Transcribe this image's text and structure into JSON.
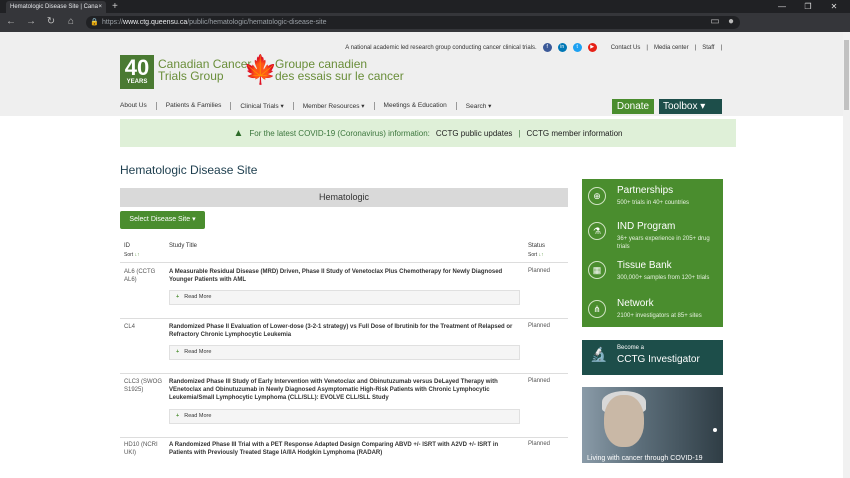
{
  "browser": {
    "tab_title": "Hematologic Disease Site | Cana",
    "tab_close": "×",
    "new_tab": "+",
    "url_scheme": "https://",
    "url_host": "www.ctg.queensu.ca",
    "url_path": "/public/hematologic/hematologic-disease-site",
    "window_buttons": [
      "—",
      "❐",
      "✕"
    ]
  },
  "header": {
    "tagline": "A national academic led research group conducting cancer clinical trials.",
    "social": [
      "f",
      "in",
      "t",
      "▶"
    ],
    "social_colors": [
      "#3b5998",
      "#0077b5",
      "#1da1f2",
      "#e62117"
    ],
    "links": [
      "Contact Us",
      "Media center",
      "Staff"
    ],
    "logo_number": "40",
    "logo_years": "YEARS",
    "logo_en_line1": "Canadian Cancer",
    "logo_en_line2": "Trials Group",
    "logo_fr_line1": "Groupe canadien",
    "logo_fr_line2": "des essais sur le cancer"
  },
  "nav": {
    "items": [
      "About Us",
      "Patients & Families",
      "Clinical Trials ▾",
      "Member Resources ▾",
      "Meetings & Education",
      "Search ▾"
    ],
    "donate": "Donate",
    "toolbox": "Toolbox ▾"
  },
  "alert": {
    "text": "For the latest COVID-19 (Coronavirus) information:",
    "link1": "CCTG public updates",
    "sep": "|",
    "link2": "CCTG member information"
  },
  "page": {
    "title": "Hematologic Disease Site",
    "section": "Hematologic",
    "select_button": "Select Disease Site ▾"
  },
  "table": {
    "col_id": "ID",
    "col_title": "Study Title",
    "col_status": "Status",
    "sort_label": "Sort",
    "sort_arrows": "↓↑",
    "read_more_icon": "+",
    "read_more": "Read More",
    "rows": [
      {
        "id": "AL6 (CCTG AL6)",
        "title": "A Measurable Residual Disease (MRD) Driven, Phase II Study of Venetoclax Plus Chemotherapy for Newly Diagnosed Younger Patients with AML",
        "status": "Planned"
      },
      {
        "id": "CL4",
        "title": "Randomized Phase II Evaluation of Lower-dose (3-2-1 strategy) vs Full Dose of Ibrutinib for the Treatment of Relapsed or Refractory Chronic Lymphocytic Leukemia",
        "status": "Planned"
      },
      {
        "id": "CLC3 (SWOG S1925)",
        "title": "Randomized Phase III Study of Early Intervention with Venetoclax and Obinutuzumab versus DeLayed Therapy with VEnetoclax and Obinutuzumab in Newly Diagnosed Asymptomatic High-Risk Patients with Chronic Lymphocytic Leukemia/Small Lymphocytic Lymphoma (CLL/SLL): EVOLVE CLL/SLL Study",
        "status": "Planned"
      },
      {
        "id": "HD10 (NCRI UKI)",
        "title": "A Randomized Phase III Trial with a PET Response Adapted Design Comparing ABVD +/- ISRT with A2VD +/- ISRT in Patients with Previously Treated Stage IA/IIA Hodgkin Lymphoma (RADAR)",
        "status": "Planned"
      }
    ]
  },
  "sidebar": {
    "items": [
      {
        "title": "Partnerships",
        "sub": "500+ trials in 40+ countries",
        "icon": "globe-icon"
      },
      {
        "title": "IND Program",
        "sub": "36+ years experience in 205+ drug trials",
        "icon": "flask-icon"
      },
      {
        "title": "Tissue Bank",
        "sub": "300,000+ samples from 120+ trials",
        "icon": "sample-icon"
      },
      {
        "title": "Network",
        "sub": "2100+ investigators at 85+ sites",
        "icon": "network-icon"
      }
    ],
    "icon_glyphs": [
      "⊕",
      "⚗",
      "▦",
      "⋔"
    ],
    "investigator_small": "Become a",
    "investigator_big": "CCTG Investigator",
    "investigator_icon": "microscope-icon",
    "photo_caption": "Living with cancer through COVID-19"
  }
}
